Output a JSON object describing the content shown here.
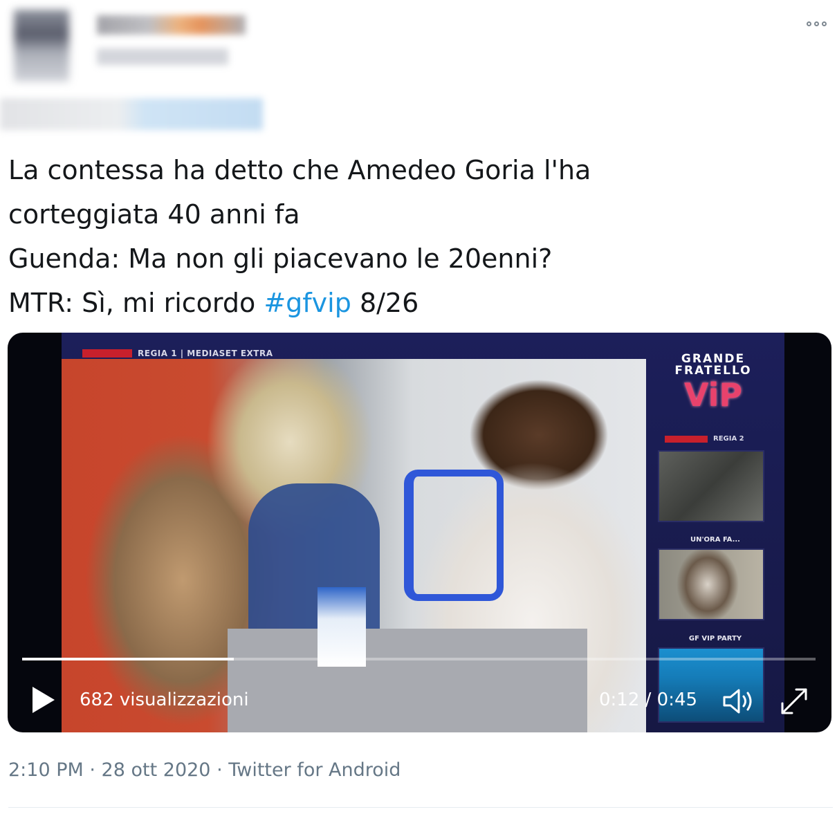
{
  "tweet": {
    "lines": [
      "La contessa ha detto che Amedeo Goria l'ha",
      "corteggiata 40 anni fa",
      "Guenda: Ma non gli piacevano le 20enni?"
    ],
    "last_line_prefix": "MTR: Sì, mi ricordo ",
    "hashtag": "#gfvip",
    "last_line_suffix": " 8/26"
  },
  "video": {
    "overlay_live_label": "REGIA 1 | MEDIASET EXTRA",
    "logo_line1": "GRANDE",
    "logo_line2": "FRATELLO",
    "logo_vip": "ViP",
    "side_live_label": "REGIA 2",
    "thumb2_label": "UN'ORA FA...",
    "thumb3_label": "GF VIP PARTY",
    "views": "682 visualizzazioni",
    "time": "0:12 / 0:45",
    "progress_fraction": 0.267
  },
  "meta": {
    "time": "2:10 PM",
    "separator": " · ",
    "date": "28 ott 2020",
    "source": "Twitter for Android"
  },
  "icons": {
    "more": "more-icon",
    "play": "play-icon",
    "volume": "volume-icon",
    "fullscreen": "fullscreen-icon"
  },
  "colors": {
    "hashtag": "#1b95e0",
    "meta_text": "#657786",
    "video_bg": "#05060d"
  }
}
